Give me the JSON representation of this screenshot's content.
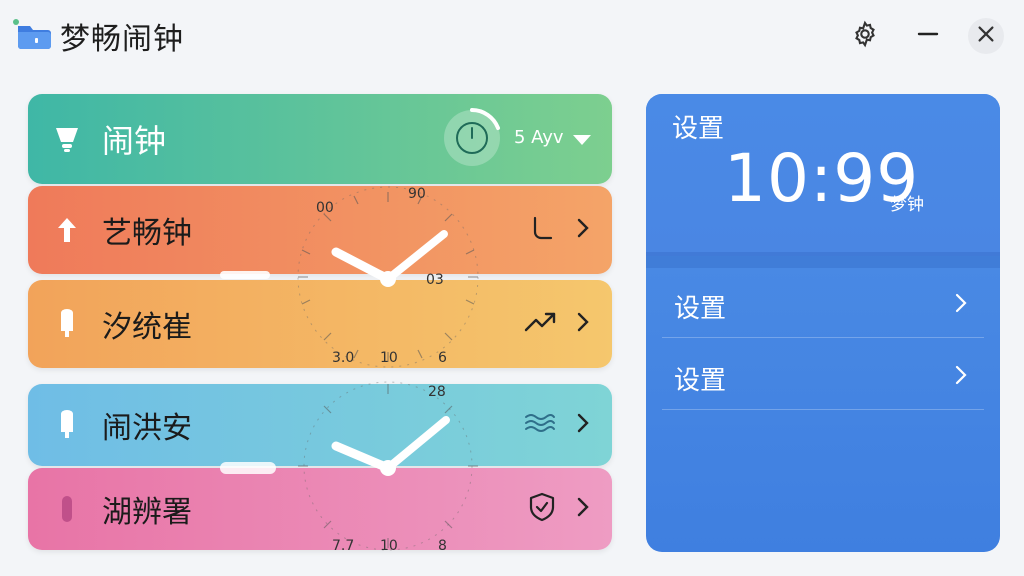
{
  "app": {
    "title": "梦畅闹钟"
  },
  "titlebar": {
    "icons": [
      "settings-gear-icon",
      "minimize-icon",
      "close-icon"
    ]
  },
  "alarms": [
    {
      "label": "闹钟",
      "icon": "bulb-icon",
      "right_icon": "power-icon",
      "period": "5 Ayv",
      "accent": "#3fb7a6"
    },
    {
      "label": "艺畅钟",
      "icon": "arrow-up-icon",
      "right_icon": "hook-icon",
      "accent": "#ef7a5a"
    },
    {
      "label": "汐统崔",
      "icon": "capsule-icon",
      "right_icon": "trend-up-icon",
      "accent": "#f2a35a"
    },
    {
      "label": "闹洪安",
      "icon": "capsule-icon",
      "right_icon": "waves-icon",
      "accent": "#6fbde6"
    },
    {
      "label": "湖辨署",
      "icon": "capsule-icon",
      "right_icon": "shield-icon",
      "accent": "#e874a6"
    }
  ],
  "clock_upper": {
    "labels": [
      "90",
      "00",
      "03",
      "3.0",
      "10",
      "6"
    ]
  },
  "clock_lower": {
    "labels": [
      "28",
      "7.7",
      "10",
      "8"
    ]
  },
  "settings": {
    "title": "设置",
    "time": "10:99",
    "time_tag": "梦钟",
    "rows": [
      {
        "label": "设置"
      },
      {
        "label": "设置"
      }
    ]
  },
  "colors": {
    "panel": "#4a86e3",
    "background": "#f3f5f8"
  }
}
